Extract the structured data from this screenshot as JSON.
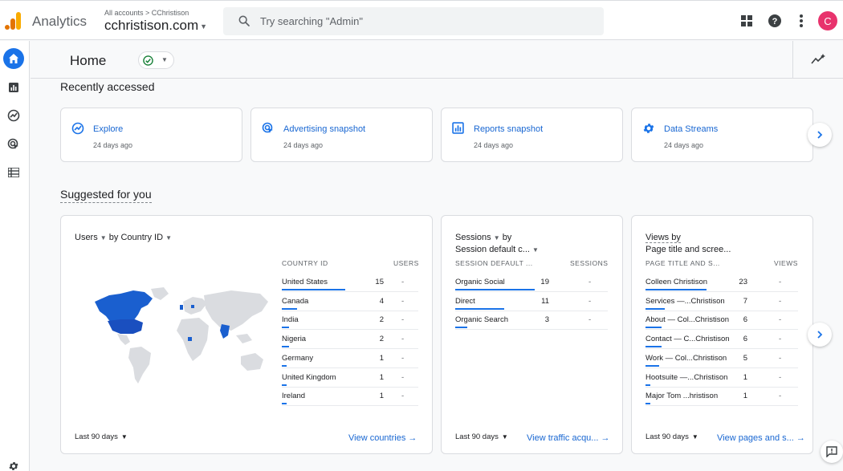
{
  "app": {
    "name": "Analytics"
  },
  "header": {
    "breadcrumb": "All accounts > CChristison",
    "property": "cchristison.com",
    "search_placeholder": "Try searching \"Admin\"",
    "avatar_letter": "C"
  },
  "page": {
    "title": "Home"
  },
  "recent": {
    "title": "Recently accessed",
    "items": [
      {
        "name": "Explore",
        "time": "24 days ago",
        "icon": "explore-icon"
      },
      {
        "name": "Advertising snapshot",
        "time": "24 days ago",
        "icon": "advertising-icon"
      },
      {
        "name": "Reports snapshot",
        "time": "24 days ago",
        "icon": "reports-icon"
      },
      {
        "name": "Data Streams",
        "time": "24 days ago",
        "icon": "gear-icon"
      }
    ]
  },
  "suggested": {
    "title": "Suggested for you",
    "cards": [
      {
        "title_metric": "Users",
        "title_dim": "by Country ID",
        "col1": "COUNTRY ID",
        "col2": "USERS",
        "rows": [
          {
            "label": "United States",
            "value": "15",
            "delta": "-",
            "fraction": 0.9
          },
          {
            "label": "Canada",
            "value": "4",
            "delta": "-",
            "fraction": 0.22
          },
          {
            "label": "India",
            "value": "2",
            "delta": "-",
            "fraction": 0.1
          },
          {
            "label": "Nigeria",
            "value": "2",
            "delta": "-",
            "fraction": 0.1
          },
          {
            "label": "Germany",
            "value": "1",
            "delta": "-",
            "fraction": 0.05
          },
          {
            "label": "United Kingdom",
            "value": "1",
            "delta": "-",
            "fraction": 0.05
          },
          {
            "label": "Ireland",
            "value": "1",
            "delta": "-",
            "fraction": 0.05
          }
        ],
        "range": "Last 90 days",
        "link": "View countries"
      },
      {
        "title_line1_metric": "Sessions",
        "title_line1_by": "by",
        "title_line2": "Session default c...",
        "col1": "SESSION DEFAULT ...",
        "col2": "SESSIONS",
        "rows": [
          {
            "label": "Organic Social",
            "value": "19",
            "delta": "-",
            "fraction": 0.9
          },
          {
            "label": "Direct",
            "value": "11",
            "delta": "-",
            "fraction": 0.55
          },
          {
            "label": "Organic Search",
            "value": "3",
            "delta": "-",
            "fraction": 0.14
          }
        ],
        "range": "Last 90 days",
        "link": "View traffic acqu..."
      },
      {
        "title_line1": "Views by",
        "title_line2": "Page title and scree...",
        "col1": "PAGE TITLE AND S...",
        "col2": "VIEWS",
        "rows": [
          {
            "label": "Colleen Christison",
            "value": "23",
            "delta": "-",
            "fraction": 0.9
          },
          {
            "label": "Services —...Christison",
            "value": "7",
            "delta": "-",
            "fraction": 0.28
          },
          {
            "label": "About — Col...Christison",
            "value": "6",
            "delta": "-",
            "fraction": 0.24
          },
          {
            "label": "Contact — C...Christison",
            "value": "6",
            "delta": "-",
            "fraction": 0.24
          },
          {
            "label": "Work — Col...Christison",
            "value": "5",
            "delta": "-",
            "fraction": 0.2
          },
          {
            "label": "Hootsuite —...Christison",
            "value": "1",
            "delta": "-",
            "fraction": 0.05
          },
          {
            "label": "Major Tom ...hristison",
            "value": "1",
            "delta": "-",
            "fraction": 0.05
          }
        ],
        "range": "Last 90 days",
        "link": "View pages and s..."
      }
    ]
  },
  "colors": {
    "accent": "#1a73e8",
    "link": "#1967d2",
    "avatar": "#e8336d",
    "map_highlight": "#1a5fcf",
    "map_base": "#dadce0"
  }
}
